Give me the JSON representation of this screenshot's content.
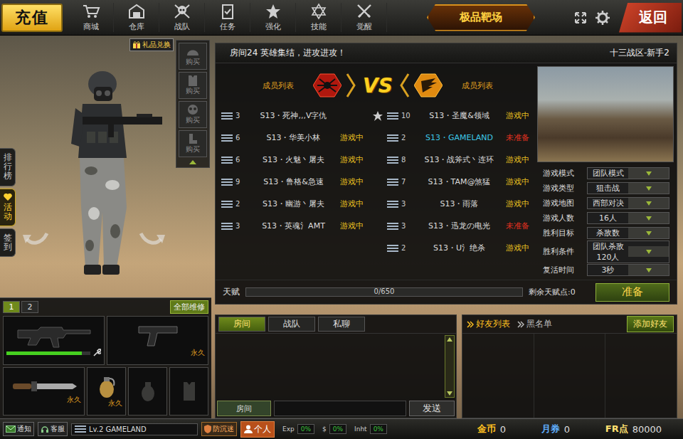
{
  "topbar": {
    "recharge": "充值",
    "nav": [
      {
        "label": "商城"
      },
      {
        "label": "仓库"
      },
      {
        "label": "战队"
      },
      {
        "label": "任务"
      },
      {
        "label": "强化"
      },
      {
        "label": "技能"
      },
      {
        "label": "觉醒"
      }
    ],
    "logo": "极品靶场",
    "back": "返回"
  },
  "gift_button": "礼品兑换",
  "side_tabs": [
    {
      "label": "排行榜",
      "selected": false
    },
    {
      "label": "活动",
      "selected": true
    },
    {
      "label": "签到",
      "selected": false
    }
  ],
  "equip_slots": [
    {
      "label": "购买"
    },
    {
      "label": "购买"
    },
    {
      "label": "购买"
    },
    {
      "label": "购买"
    }
  ],
  "weapon_tabs": [
    {
      "label": "1",
      "selected": true
    },
    {
      "label": "2",
      "selected": false
    }
  ],
  "repair_all": "全部维修",
  "weapons": [
    {
      "kind": "rifle",
      "durability": 0.9
    },
    {
      "kind": "pistol",
      "term": "永久"
    },
    {
      "kind": "knife",
      "term": "永久"
    },
    {
      "kind": "grenade",
      "term": "永久"
    },
    {
      "kind": "empty-grenade"
    },
    {
      "kind": "empty-armor"
    }
  ],
  "room": {
    "title": "房间24 英雄集结，进攻进攻！",
    "zone": "十三战区-新手2",
    "vs": "VS",
    "teams": [
      {
        "label": "成员列表",
        "members": [
          {
            "rank": "3",
            "name": "S13・死神,,,V字仇",
            "host": true,
            "self": false
          },
          {
            "rank": "6",
            "name": "S13・华美小林",
            "status": "游戏中",
            "color": "#e8c020",
            "host": false,
            "self": false
          },
          {
            "rank": "6",
            "name": "S13・火魅丶屠夫",
            "status": "游戏中",
            "color": "#e8c020",
            "host": false,
            "self": false
          },
          {
            "rank": "9",
            "name": "S13・鲁格&急速",
            "status": "游戏中",
            "color": "#e8c020",
            "host": false,
            "self": false
          },
          {
            "rank": "2",
            "name": "S13・幽游丶屠夫",
            "status": "游戏中",
            "color": "#e8c020",
            "host": false,
            "self": false
          },
          {
            "rank": "3",
            "name": "S13・英魂氵AMT",
            "status": "游戏中",
            "color": "#e8c020",
            "host": false,
            "self": false
          }
        ]
      },
      {
        "label": "成员列表",
        "members": [
          {
            "rank": "10",
            "name": "S13・圣魔&领域",
            "status": "游戏中",
            "color": "#e8c020",
            "host": false,
            "self": false
          },
          {
            "rank": "2",
            "name": "S13・GAMELAND",
            "status": "未准备",
            "color": "#e03020",
            "host": false,
            "self": true
          },
          {
            "rank": "8",
            "name": "S13・战斧式丶连环",
            "status": "游戏中",
            "color": "#e8c020",
            "host": false,
            "self": false
          },
          {
            "rank": "7",
            "name": "S13・TAM@煞猛",
            "status": "游戏中",
            "color": "#e8c020",
            "host": false,
            "self": false
          },
          {
            "rank": "3",
            "name": "S13・雨落",
            "status": "游戏中",
            "color": "#e8c020",
            "host": false,
            "self": false
          },
          {
            "rank": "3",
            "name": "S13・迅龙の电光",
            "status": "未准备",
            "color": "#e03020",
            "host": false,
            "self": false
          },
          {
            "rank": "2",
            "name": "S13・U氵绝杀",
            "status": "游戏中",
            "color": "#e8c020",
            "host": false,
            "self": false
          }
        ]
      }
    ]
  },
  "settings": [
    {
      "label": "游戏模式",
      "value": "团队模式"
    },
    {
      "label": "游戏类型",
      "value": "狙击战"
    },
    {
      "label": "游戏地图",
      "value": "西部对决"
    },
    {
      "label": "游戏人数",
      "value": "16人"
    },
    {
      "label": "胜利目标",
      "value": "杀敌数"
    },
    {
      "label": "胜利条件",
      "value": "团队杀敌120人"
    },
    {
      "label": "复活时间",
      "value": "3秒"
    }
  ],
  "talent": {
    "label": "天赋",
    "reading": "0/650",
    "level": 0,
    "remaining": "剩余天赋点:0"
  },
  "ready_button": "准备",
  "chat": {
    "tabs": [
      {
        "label": "房间",
        "selected": true
      },
      {
        "label": "战队",
        "selected": false
      },
      {
        "label": "私聊",
        "selected": false
      }
    ],
    "channel": "房间",
    "send": "发送"
  },
  "friends": {
    "tabs": [
      {
        "label": "好友列表",
        "selected": true
      },
      {
        "label": "黑名单",
        "selected": false
      }
    ],
    "add": "添加好友"
  },
  "status_bar": {
    "notice": "通知",
    "service": "客服",
    "player": "Lv.2 GAMELAND",
    "anti_addiction": "防沉迷",
    "personal": "个人",
    "stats": [
      {
        "label": "Exp",
        "value": "0%"
      },
      {
        "label": "$",
        "value": "0%"
      },
      {
        "label": "Inht",
        "value": "0%"
      }
    ],
    "currencies": [
      {
        "label": "金币",
        "value": "0",
        "color": "#ffc020"
      },
      {
        "label": "月券",
        "value": "0",
        "color": "#60b0ff"
      },
      {
        "label": "FR点",
        "value": "80000",
        "color": "#ffe070"
      }
    ]
  }
}
